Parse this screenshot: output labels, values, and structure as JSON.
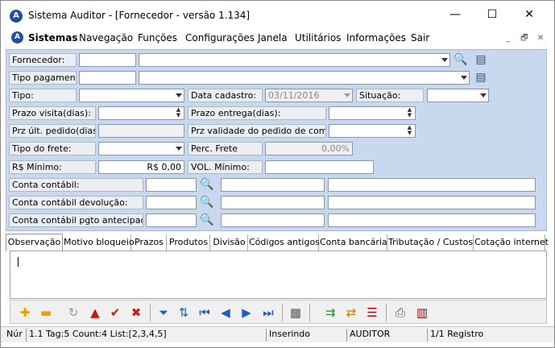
{
  "window": {
    "title": "Sistema Auditor - [Fornecedor - versão 1.134]",
    "logo_letter": "A",
    "controls": {
      "minimize": "—",
      "maximize": "☐",
      "close": "✕"
    }
  },
  "menu": {
    "logo_letter": "A",
    "items": [
      "Sistemas",
      "Navegação",
      "Funções",
      "Configurações",
      "Janela",
      "Utilitários",
      "Informações",
      "Sair"
    ],
    "mdi_controls": [
      "_",
      "🗗",
      "✕"
    ]
  },
  "form": {
    "fornecedor": {
      "label": "Fornecedor:",
      "code": "",
      "name": ""
    },
    "tipo_pagamento": {
      "label": "Tipo pagamento:",
      "code": "",
      "name": ""
    },
    "tipo": {
      "label": "Tipo:",
      "value": ""
    },
    "data_cadastro": {
      "label": "Data cadastro:",
      "value": "03/11/2016"
    },
    "situacao": {
      "label": "Situação:",
      "value": ""
    },
    "prazo_visita": {
      "label": "Prazo visita(dias):",
      "value": ""
    },
    "prazo_entrega": {
      "label": "Prazo entrega(dias):",
      "value": ""
    },
    "prz_ult_pedido": {
      "label": "Prz últ. pedido(dias):",
      "value": ""
    },
    "prz_validade": {
      "label": "Prz validade do pedido de compra:",
      "value": ""
    },
    "tipo_frete": {
      "label": "Tipo do frete:",
      "value": ""
    },
    "perc_frete": {
      "label": "Perc. Frete",
      "value": "0,00%"
    },
    "rs_minimo": {
      "label": "R$ Mínimo:",
      "value": "R$ 0,00"
    },
    "vol_minimo": {
      "label": "VOL. Mínimo:",
      "value": ""
    },
    "conta_contabil": {
      "label": "Conta contábil:"
    },
    "conta_contabil_devolucao": {
      "label": "Conta contábil devolução:"
    },
    "conta_contabil_pgto": {
      "label": "Conta contábil pgto antecipado:"
    }
  },
  "tabs": [
    "Observação",
    "Motivo bloqueio",
    "Prazos",
    "Produtos",
    "Divisão",
    "Códigos antigos",
    "Conta bancária",
    "Tributação / Custos",
    "Cotação internet"
  ],
  "icons": {
    "search": "🔍",
    "lookup": "▤"
  },
  "statusbar": {
    "label": "Núr",
    "info": "1.1 Tag:5 Count:4 List:[2,3,4,5]",
    "mode": "Inserindo",
    "user": "AUDITOR",
    "records": "1/1 Registro"
  },
  "colors": {
    "form_bg": "#c8d9ef",
    "logo": "#1e4fa3"
  }
}
